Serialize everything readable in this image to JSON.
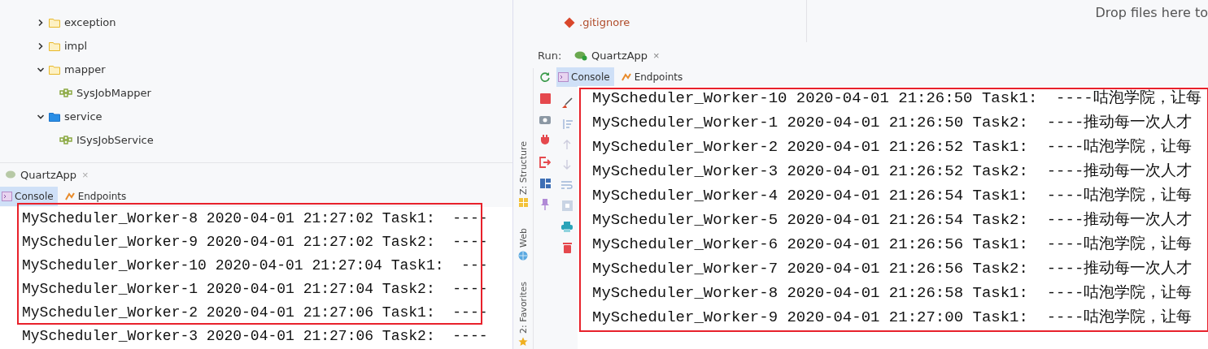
{
  "left_window": {
    "project_tree": [
      {
        "label": "exception",
        "kind": "package",
        "expanded": false
      },
      {
        "label": "impl",
        "kind": "package",
        "expanded": false
      },
      {
        "label": "mapper",
        "kind": "package",
        "expanded": true,
        "children": [
          {
            "label": "SysJobMapper",
            "kind": "interface"
          }
        ]
      },
      {
        "label": "service",
        "kind": "service-package",
        "expanded": true,
        "children": [
          {
            "label": "ISysJobService",
            "kind": "interface"
          }
        ]
      }
    ],
    "run_panel": {
      "tab": {
        "label": "QuartzApp",
        "close": "×"
      },
      "tabs": [
        {
          "label": "Console",
          "kind": "console",
          "selected": true
        },
        {
          "label": "Endpoints",
          "kind": "endpoints",
          "selected": false
        }
      ],
      "console_lines": [
        "MyScheduler_Worker-8 2020-04-01 21:27:02 Task1:  ----",
        "MyScheduler_Worker-9 2020-04-01 21:27:02 Task2:  ----",
        "MyScheduler_Worker-10 2020-04-01 21:27:04 Task1:  ---",
        "MyScheduler_Worker-1 2020-04-01 21:27:04 Task2:  ----",
        "MyScheduler_Worker-2 2020-04-01 21:27:06 Task1:  ----",
        "MyScheduler_Worker-3 2020-04-01 21:27:06 Task2:  ----"
      ]
    }
  },
  "right_window": {
    "project_tree": [
      {
        "label": ".gitignore",
        "kind": "git-file"
      }
    ],
    "editor": {
      "hint": "Drop files here to"
    },
    "tool_windows": [
      {
        "label": "Z: Structure",
        "kind": "structure"
      },
      {
        "label": "Web",
        "kind": "web"
      },
      {
        "label": "2: Favorites",
        "kind": "favorites"
      }
    ],
    "run_panel": {
      "run_label": "Run:",
      "tab": {
        "label": "QuartzApp",
        "close": "×"
      },
      "tabs": [
        {
          "label": "Console",
          "kind": "console",
          "selected": true
        },
        {
          "label": "Endpoints",
          "kind": "endpoints",
          "selected": false
        }
      ],
      "console_lines": [
        "MyScheduler_Worker-10 2020-04-01 21:26:50 Task1:  ----咕泡学院，让每",
        "MyScheduler_Worker-1 2020-04-01 21:26:50 Task2:  ----推动每一次人才",
        "MyScheduler_Worker-2 2020-04-01 21:26:52 Task1:  ----咕泡学院，让每",
        "MyScheduler_Worker-3 2020-04-01 21:26:52 Task2:  ----推动每一次人才",
        "MyScheduler_Worker-4 2020-04-01 21:26:54 Task1:  ----咕泡学院，让每",
        "MyScheduler_Worker-5 2020-04-01 21:26:54 Task2:  ----推动每一次人才",
        "MyScheduler_Worker-6 2020-04-01 21:26:56 Task1:  ----咕泡学院，让每",
        "MyScheduler_Worker-7 2020-04-01 21:26:56 Task2:  ----推动每一次人才",
        "MyScheduler_Worker-8 2020-04-01 21:26:58 Task1:  ----咕泡学院，让每",
        "MyScheduler_Worker-9 2020-04-01 21:27:00 Task1:  ----咕泡学院，让每"
      ]
    }
  }
}
